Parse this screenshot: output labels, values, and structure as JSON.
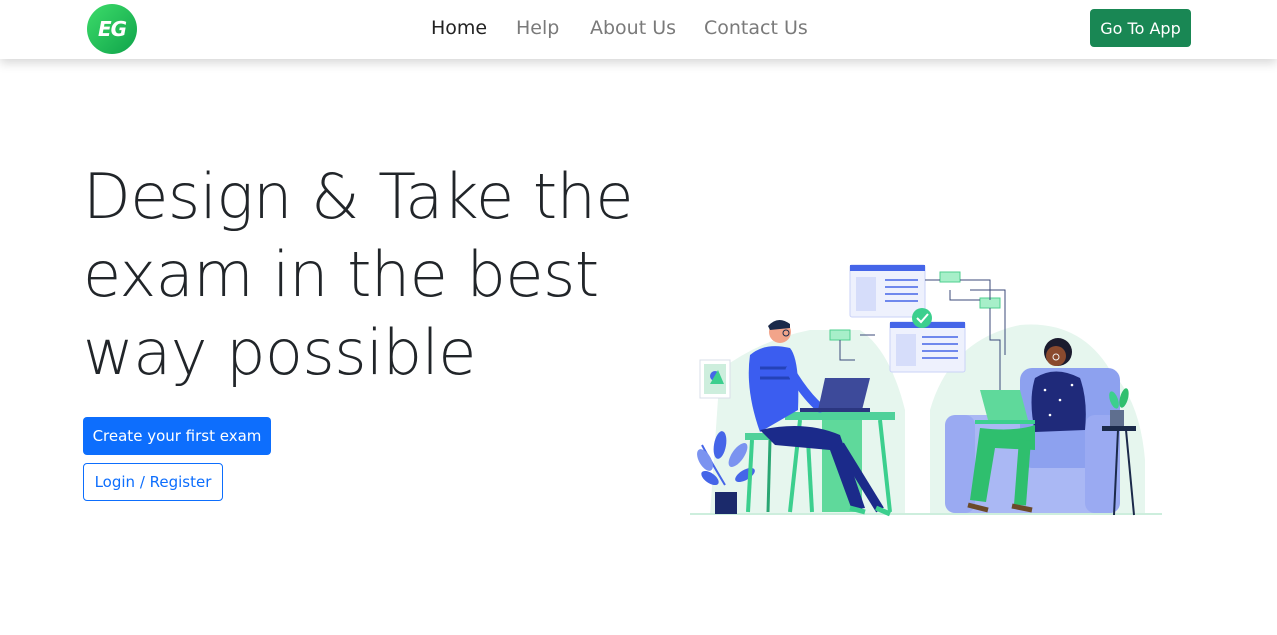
{
  "header": {
    "logo_text": "EG",
    "nav": [
      {
        "label": "Home",
        "active": true
      },
      {
        "label": "Help",
        "active": false
      },
      {
        "label": "About Us",
        "active": false
      },
      {
        "label": "Contact Us",
        "active": false
      }
    ],
    "cta_label": "Go To App"
  },
  "hero": {
    "title": "Design & Take the exam in the best way possible",
    "primary_button": "Create your first exam",
    "secondary_button": "Login / Register"
  },
  "colors": {
    "brand_green": "#198754",
    "primary_blue": "#0d6efd",
    "logo_green": "#1fbf55",
    "illustration_green": "#5fd99b",
    "illustration_blue": "#4565e8"
  },
  "icons": [
    "logo-icon",
    "people-working-illustration"
  ]
}
